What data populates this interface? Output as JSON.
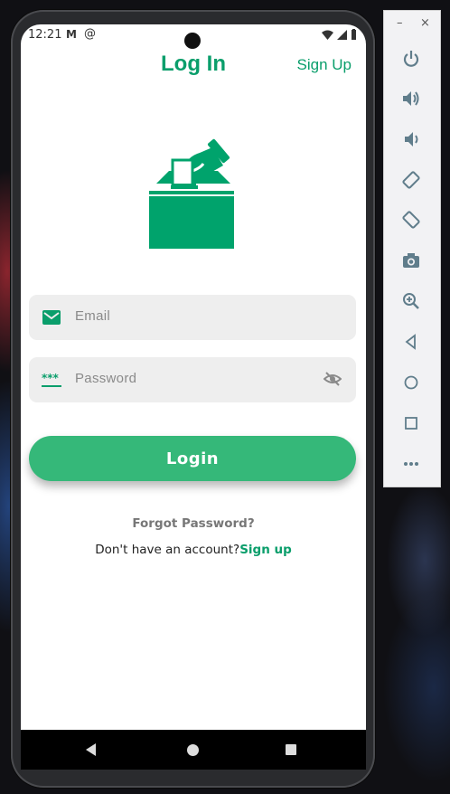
{
  "status_bar": {
    "time": "12:21",
    "mail_icon": "M",
    "at_icon": "@"
  },
  "header": {
    "title": "Log In",
    "signup_link": "Sign Up"
  },
  "logo": {
    "icon": "ballot-box-vote-icon",
    "color": "#00a36c"
  },
  "form": {
    "email_placeholder": "Email",
    "password_placeholder": "Password",
    "login_label": "Login",
    "forgot_label": "Forgot Password?",
    "no_account_text": "Don't have an account?",
    "signup_label": "Sign up"
  },
  "colors": {
    "accent": "#0a9e6b",
    "button": "#35b879",
    "field_bg": "#eeeeee"
  },
  "emulator_toolbar": {
    "minimize": "–",
    "close": "×",
    "buttons": [
      "power-icon",
      "volume-up-icon",
      "volume-down-icon",
      "rotate-left-icon",
      "rotate-right-icon",
      "camera-icon",
      "zoom-icon",
      "back-icon",
      "home-icon",
      "overview-icon",
      "more-icon"
    ]
  }
}
